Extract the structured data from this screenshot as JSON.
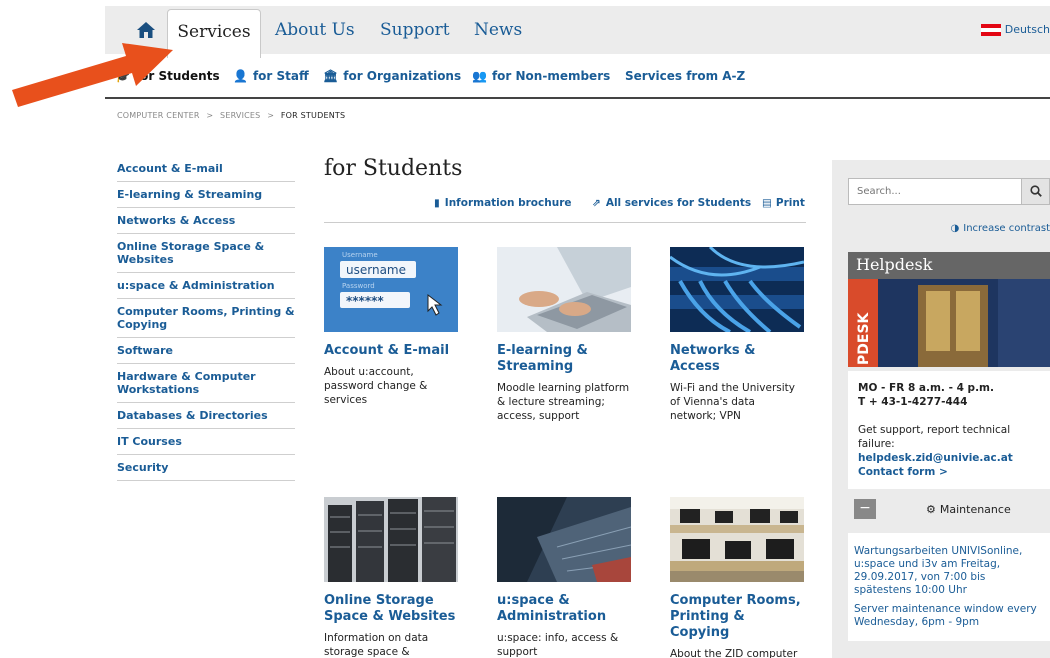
{
  "topnav": {
    "tabs": [
      "Services",
      "About Us",
      "Support",
      "News"
    ],
    "language": "Deutsch"
  },
  "subnav": {
    "items": [
      "for Students",
      "for Staff",
      "for Organizations",
      "for Non-members",
      "Services from A-Z"
    ]
  },
  "breadcrumb": {
    "items": [
      "COMPUTER CENTER",
      "SERVICES",
      "FOR STUDENTS"
    ],
    "separator": ">"
  },
  "leftmenu": {
    "items": [
      "Account & E-mail",
      "E-learning & Streaming",
      "Networks & Access",
      "Online Storage Space & Websites",
      "u:space & Administration",
      "Computer Rooms, Printing & Copying",
      "Software",
      "Hardware & Computer Workstations",
      "Databases & Directories",
      "IT Courses",
      "Security"
    ]
  },
  "main": {
    "title": "for Students",
    "tools": [
      "Information brochure",
      "All services for Students",
      "Print"
    ],
    "cards": [
      {
        "title": "Account & E-mail",
        "desc": "About u:account, password change & services",
        "image_text_1": "Username",
        "image_text_2": "username",
        "image_text_3": "Password",
        "image_text_4": "******"
      },
      {
        "title": "E-learning & Streaming",
        "desc": "Moodle learning platform & lecture streaming; access, support"
      },
      {
        "title": "Networks & Access",
        "desc": "Wi-Fi and the University of Vienna's data network; VPN"
      },
      {
        "title": "Online Storage Space & Websites",
        "desc": "Information on data storage space &"
      },
      {
        "title": "u:space & Administration",
        "desc": "u:space: info, access & support"
      },
      {
        "title": "Computer Rooms, Printing & Copying",
        "desc": "About the ZID computer rooms &"
      }
    ]
  },
  "sidebar": {
    "search_placeholder": "Search...",
    "contrast": "Increase contrast",
    "helpdesk": {
      "title": "Helpdesk",
      "image_sign": "PDESK",
      "hours": "MO - FR  8 a.m. - 4 p.m.",
      "phone": "T + 43-1-4277-444",
      "support_text": "Get support, report technical failure:",
      "email": "helpdesk.zid@univie.ac.at",
      "contact": "Contact form >"
    },
    "maintenance": {
      "label": "Maintenance",
      "toggle": "−",
      "notice_1": "Wartungsarbeiten UNIVISonline, u:space und i3v am Freitag, 29.09.2017, von 7:00 bis spätestens 10:00 Uhr",
      "notice_2": "Server maintenance window every Wednesday, 6pm - 9pm"
    }
  },
  "colors": {
    "link": "#1a5c96",
    "arrow": "#e8501c",
    "nav_bg": "#ececec",
    "sidebar_bg": "#ebebeb"
  }
}
